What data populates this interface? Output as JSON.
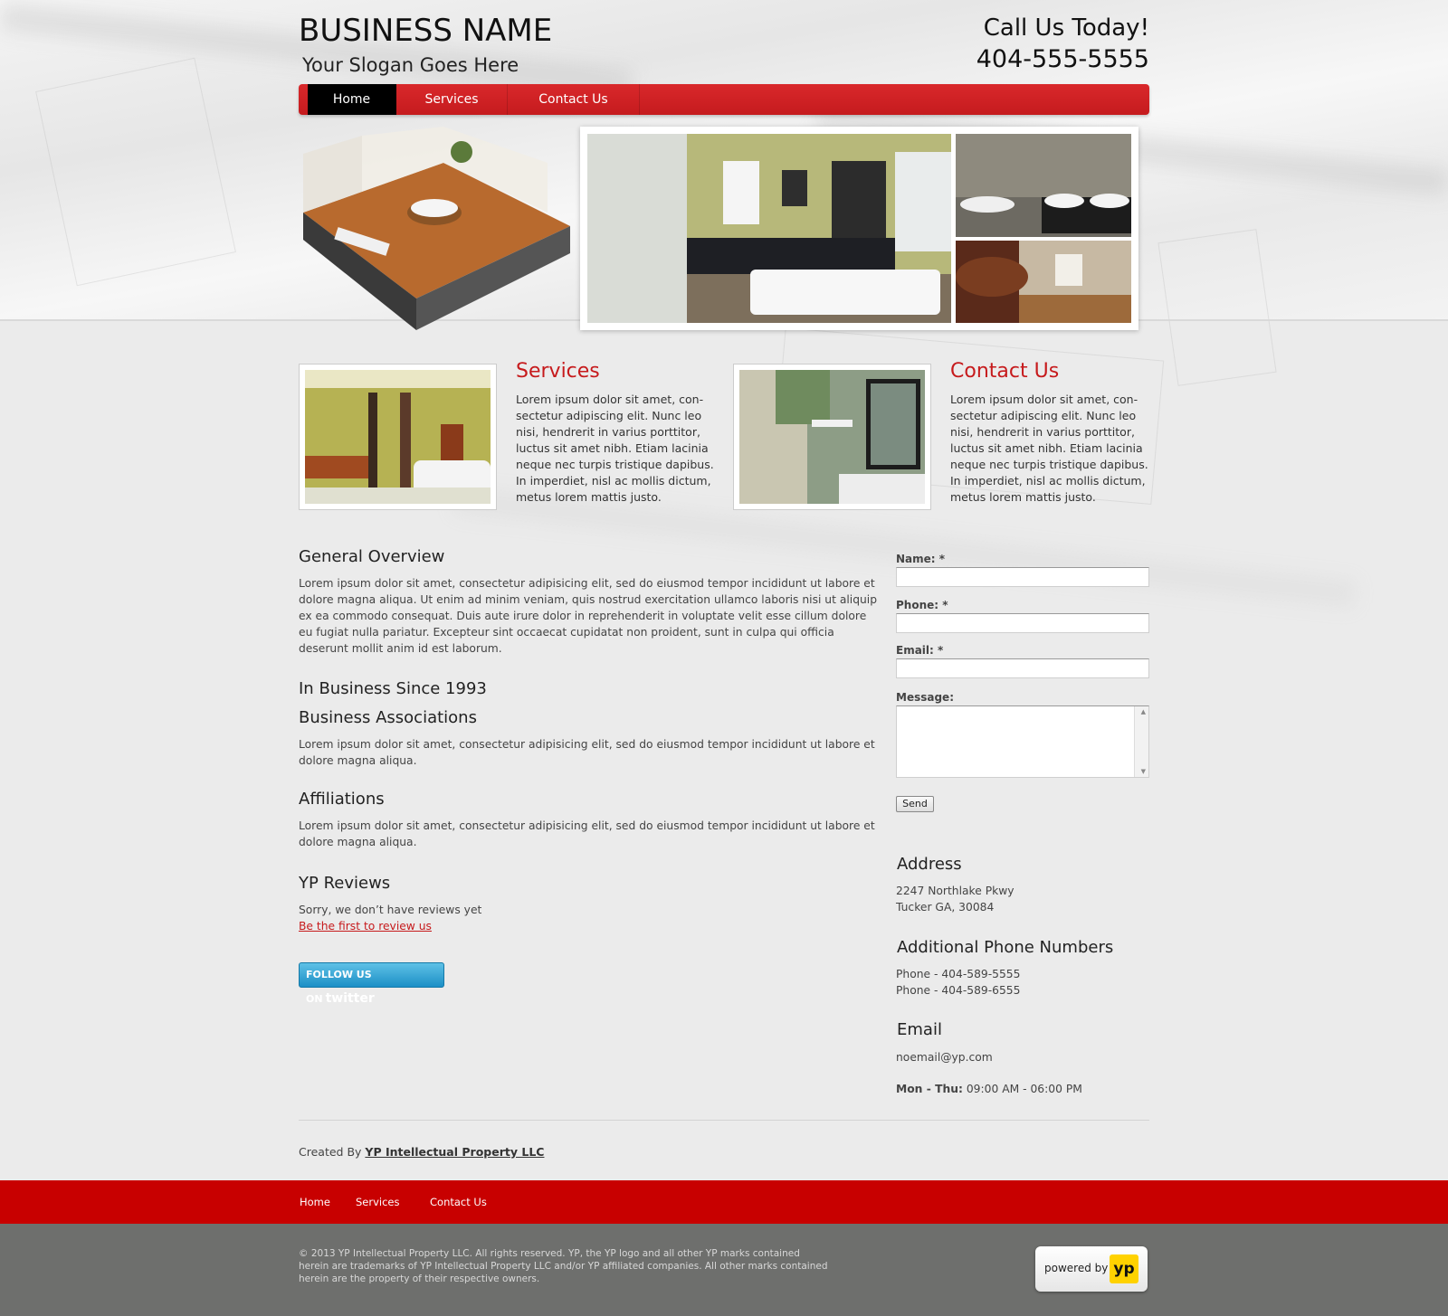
{
  "header": {
    "business_name": "BUSINESS NAME",
    "slogan": "Your Slogan Goes Here",
    "call_title": "Call Us Today!",
    "call_phone": "404-555-5555"
  },
  "nav": {
    "items": [
      {
        "label": "Home",
        "active": true
      },
      {
        "label": "Services",
        "active": false
      },
      {
        "label": "Contact Us",
        "active": false
      }
    ]
  },
  "features": [
    {
      "title": "Services",
      "text": "Lorem ipsum dolor sit amet, con-sectetur adipiscing elit. Nunc leo nisi, hendrerit in varius porttitor, luctus sit amet nibh. Etiam lacinia neque nec turpis tristique dapibus. In imperdiet, nisl ac mollis dictum, metus lorem mattis justo."
    },
    {
      "title": "Contact Us",
      "text": "Lorem ipsum dolor sit amet, con-sectetur adipiscing elit. Nunc leo nisi, hendrerit in varius porttitor, luctus sit amet nibh. Etiam lacinia neque nec turpis tristique dapibus. In imperdiet, nisl ac mollis dictum, metus lorem mattis justo."
    }
  ],
  "main": {
    "overview_title": "General Overview",
    "overview_text": "Lorem ipsum dolor sit amet, consectetur adipisicing elit, sed do eiusmod tempor incididunt ut labore et dolore magna aliqua. Ut enim ad minim veniam, quis nostrud exercitation ullamco laboris nisi ut aliquip ex ea commodo consequat. Duis aute irure dolor in reprehenderit in voluptate velit esse cillum dolore eu fugiat nulla pariatur. Excepteur sint occaecat cupidatat non proident, sunt in culpa qui officia deserunt mollit anim id est laborum.",
    "since_title": "In Business Since 1993",
    "associations_title": "Business Associations",
    "associations_text": "Lorem ipsum dolor sit amet, consectetur adipisicing elit, sed do eiusmod tempor incididunt ut labore et dolore magna aliqua.",
    "affiliations_title": "Affiliations",
    "affiliations_text": "Lorem ipsum dolor sit amet, consectetur adipisicing elit, sed do eiusmod tempor incididunt ut labore et dolore magna aliqua.",
    "reviews_title": "YP Reviews",
    "reviews_text": "Sorry, we don’t have reviews yet",
    "reviews_link": "Be the first to review us",
    "twitter_prefix": "FOLLOW US ON",
    "twitter_word": "twitter"
  },
  "form": {
    "name_label": "Name: *",
    "phone_label": "Phone: *",
    "email_label": "Email: *",
    "message_label": "Message:",
    "send_label": "Send"
  },
  "sidebar": {
    "address_title": "Address",
    "address_line1": "2247 Northlake Pkwy",
    "address_line2": "Tucker GA, 30084",
    "phones_title": "Additional Phone Numbers",
    "phone1": "Phone - 404-589-5555",
    "phone2": "Phone - 404-589-6555",
    "email_title": "Email",
    "email": "noemail@yp.com",
    "hours_days": "Mon - Thu:",
    "hours_time": "09:00 AM - 06:00 PM"
  },
  "credit": {
    "prefix": "Created By",
    "company": "YP Intellectual Property LLC"
  },
  "footer": {
    "links": [
      "Home",
      "Services",
      "Contact Us"
    ],
    "copyright": "© 2013  YP Intellectual Property LLC. All rights reserved. YP, the YP logo and all other YP marks contained herein are trademarks of YP Intellectual Property LLC and/or YP affiliated companies. All other marks contained herein are the property of their respective owners.",
    "powered_text": "powered by",
    "yp_logo_text": "yp"
  },
  "colors": {
    "accent_red": "#c61a1c",
    "footer_red": "#c80000",
    "footer_grey": "#6e6f6d"
  }
}
